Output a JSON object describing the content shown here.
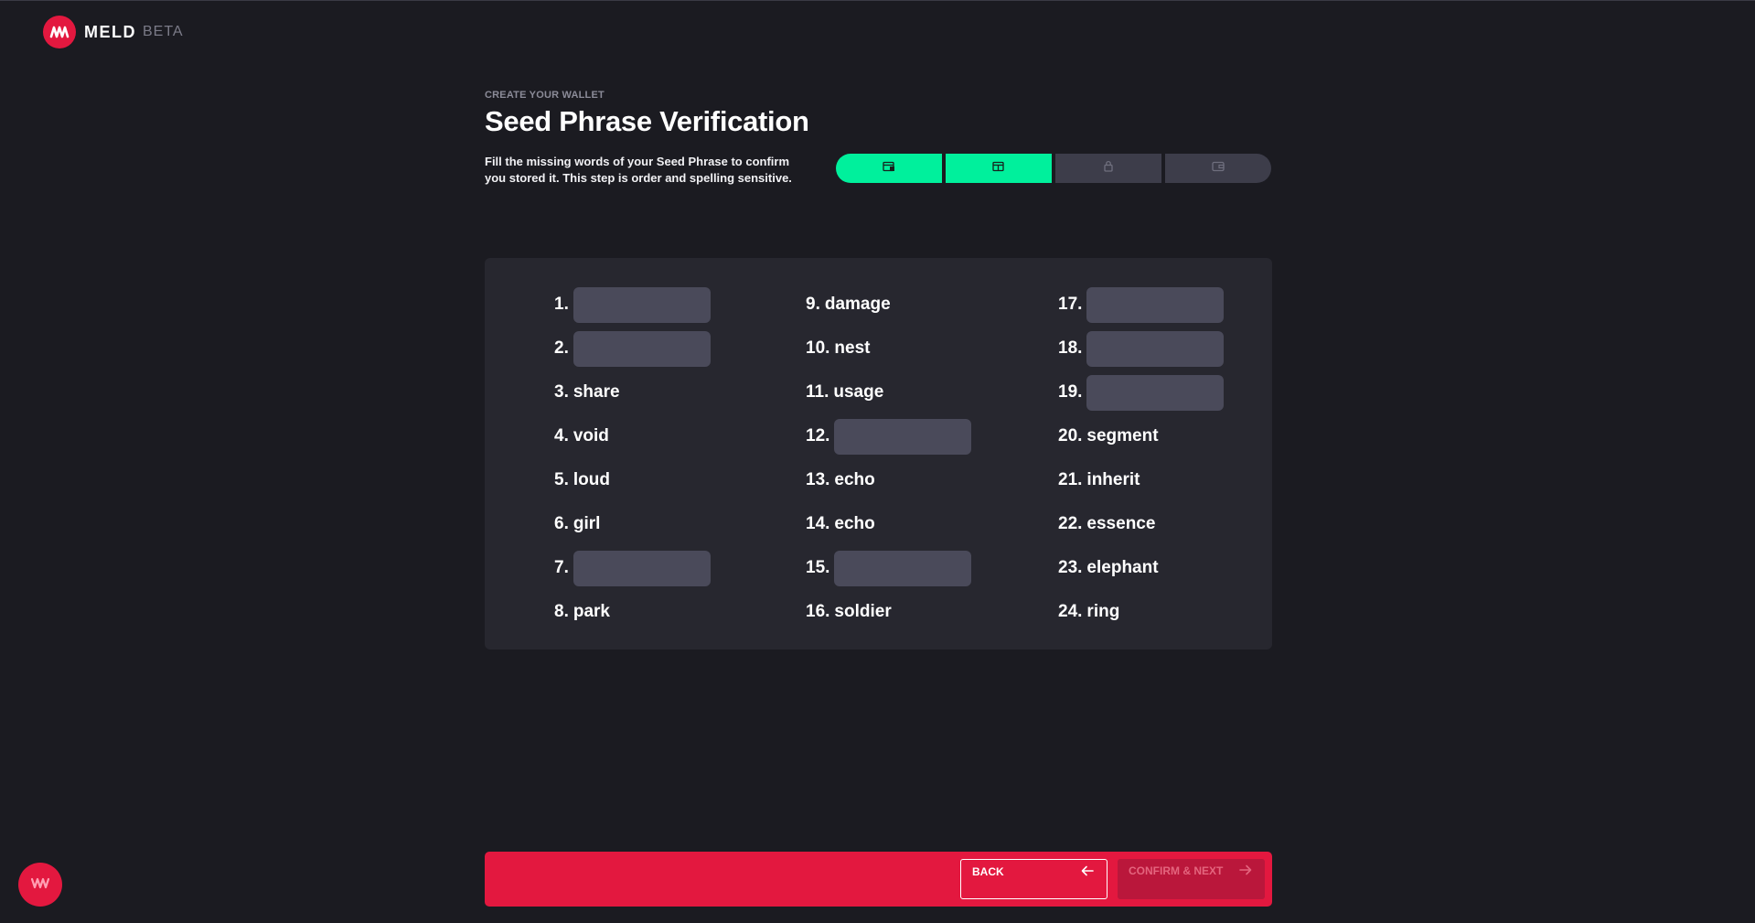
{
  "brand": {
    "name": "MELD",
    "tag": "BETA"
  },
  "header": {
    "eyebrow": "CREATE YOUR WALLET",
    "title": "Seed Phrase Verification",
    "description_line1": "Fill the missing words of your Seed Phrase to confirm",
    "description_line2": "you stored it. This step is order and spelling sensitive."
  },
  "stepper": {
    "steps": [
      {
        "icon": "wallet-add-icon",
        "status": "done"
      },
      {
        "icon": "wallet-check-icon",
        "status": "done"
      },
      {
        "icon": "lock-icon",
        "status": "pending"
      },
      {
        "icon": "wallet-icon",
        "status": "pending"
      }
    ]
  },
  "seed_words": {
    "w1": {
      "num": "1.",
      "word": ""
    },
    "w2": {
      "num": "2.",
      "word": ""
    },
    "w3": {
      "num": "3.",
      "word": "share"
    },
    "w4": {
      "num": "4.",
      "word": "void"
    },
    "w5": {
      "num": "5.",
      "word": "loud"
    },
    "w6": {
      "num": "6.",
      "word": "girl"
    },
    "w7": {
      "num": "7.",
      "word": ""
    },
    "w8": {
      "num": "8.",
      "word": "park"
    },
    "w9": {
      "num": "9.",
      "word": "damage"
    },
    "w10": {
      "num": "10.",
      "word": "nest"
    },
    "w11": {
      "num": "11.",
      "word": "usage"
    },
    "w12": {
      "num": "12.",
      "word": ""
    },
    "w13": {
      "num": "13.",
      "word": "echo"
    },
    "w14": {
      "num": "14.",
      "word": "echo"
    },
    "w15": {
      "num": "15.",
      "word": ""
    },
    "w16": {
      "num": "16.",
      "word": "soldier"
    },
    "w17": {
      "num": "17.",
      "word": ""
    },
    "w18": {
      "num": "18.",
      "word": ""
    },
    "w19": {
      "num": "19.",
      "word": ""
    },
    "w20": {
      "num": "20.",
      "word": "segment"
    },
    "w21": {
      "num": "21.",
      "word": "inherit"
    },
    "w22": {
      "num": "22.",
      "word": "essence"
    },
    "w23": {
      "num": "23.",
      "word": "elephant"
    },
    "w24": {
      "num": "24.",
      "word": "ring"
    }
  },
  "footer": {
    "back_label": "BACK",
    "next_label": "CONFIRM & NEXT",
    "back_icon": "arrow-left-icon",
    "next_icon": "arrow-right-icon"
  },
  "colors": {
    "accent": "#e3183f",
    "success": "#00f09c",
    "background": "#1b1b21",
    "card": "#27272f",
    "input": "#4a4a5a"
  }
}
